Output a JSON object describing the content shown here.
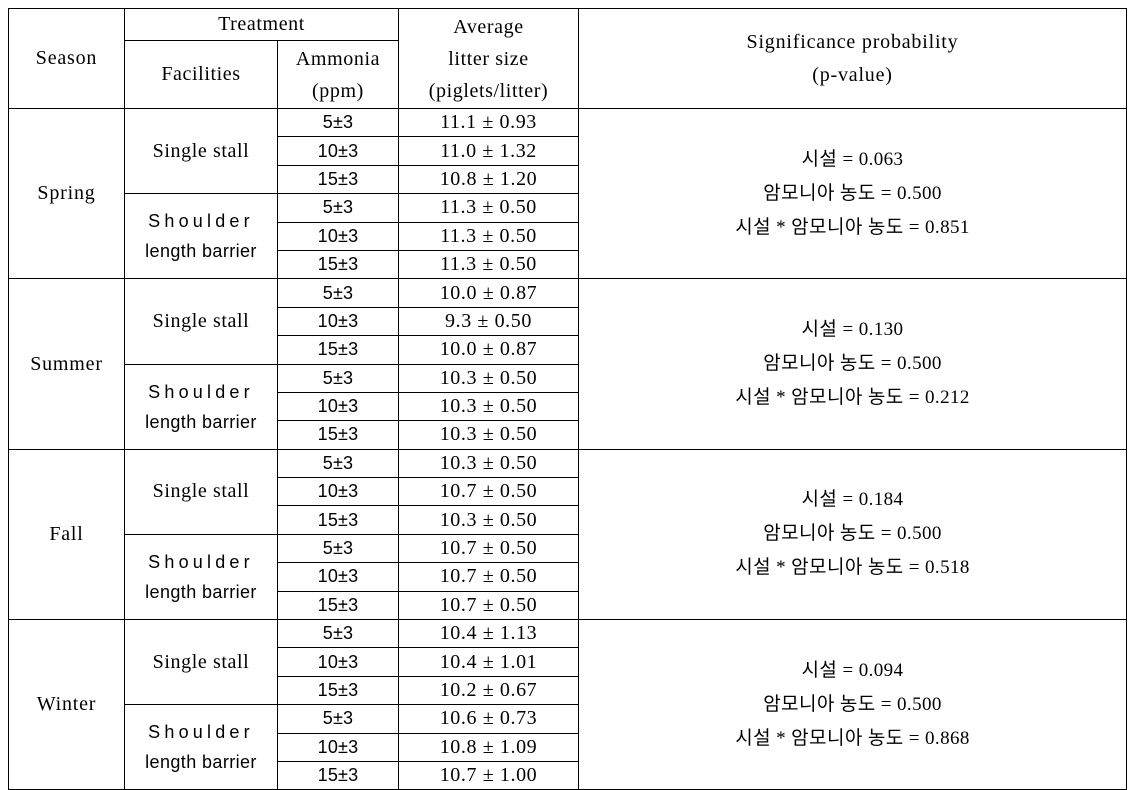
{
  "table": {
    "headers": {
      "season": "Season",
      "treatment": "Treatment",
      "facilities": "Facilities",
      "ammonia_line1": "Ammonia",
      "ammonia_line2": "(ppm)",
      "average_line1": "Average",
      "average_line2": "litter size",
      "average_line3": "(piglets/litter)",
      "significance_line1": "Significance probability",
      "significance_line2": "(p-value)"
    },
    "facility_labels": {
      "single_stall": "Single stall",
      "shoulder_word": "Shoulder",
      "shoulder_rest": "length barrier"
    },
    "ammonia_levels": [
      "5±3",
      "10±3",
      "15±3"
    ],
    "seasons": [
      {
        "name": "Spring",
        "groups": [
          {
            "facility": "Single stall",
            "rows": [
              {
                "ammonia": "5±3",
                "litter_size": "11.1 ± 0.93"
              },
              {
                "ammonia": "10±3",
                "litter_size": "11.0 ± 1.32"
              },
              {
                "ammonia": "15±3",
                "litter_size": "10.8 ± 1.20"
              }
            ]
          },
          {
            "facility": "Shoulder length barrier",
            "rows": [
              {
                "ammonia": "5±3",
                "litter_size": "11.3 ± 0.50"
              },
              {
                "ammonia": "10±3",
                "litter_size": "11.3 ± 0.50"
              },
              {
                "ammonia": "15±3",
                "litter_size": "11.3 ± 0.50"
              }
            ]
          }
        ],
        "significance": {
          "line1": "시설 = 0.063",
          "line2": "암모니아 농도 = 0.500",
          "line3": "시설 * 암모니아 농도 = 0.851"
        }
      },
      {
        "name": "Summer",
        "groups": [
          {
            "facility": "Single stall",
            "rows": [
              {
                "ammonia": "5±3",
                "litter_size": "10.0 ± 0.87"
              },
              {
                "ammonia": "10±3",
                "litter_size": "9.3 ± 0.50"
              },
              {
                "ammonia": "15±3",
                "litter_size": "10.0 ± 0.87"
              }
            ]
          },
          {
            "facility": "Shoulder length barrier",
            "rows": [
              {
                "ammonia": "5±3",
                "litter_size": "10.3 ± 0.50"
              },
              {
                "ammonia": "10±3",
                "litter_size": "10.3 ± 0.50"
              },
              {
                "ammonia": "15±3",
                "litter_size": "10.3 ± 0.50"
              }
            ]
          }
        ],
        "significance": {
          "line1": "시설 = 0.130",
          "line2": "암모니아 농도 = 0.500",
          "line3": "시설 * 암모니아 농도 = 0.212"
        }
      },
      {
        "name": "Fall",
        "groups": [
          {
            "facility": "Single stall",
            "rows": [
              {
                "ammonia": "5±3",
                "litter_size": "10.3 ± 0.50"
              },
              {
                "ammonia": "10±3",
                "litter_size": "10.7 ± 0.50"
              },
              {
                "ammonia": "15±3",
                "litter_size": "10.3 ± 0.50"
              }
            ]
          },
          {
            "facility": "Shoulder length barrier",
            "rows": [
              {
                "ammonia": "5±3",
                "litter_size": "10.7 ± 0.50"
              },
              {
                "ammonia": "10±3",
                "litter_size": "10.7 ± 0.50"
              },
              {
                "ammonia": "15±3",
                "litter_size": "10.7 ± 0.50"
              }
            ]
          }
        ],
        "significance": {
          "line1": "시설 = 0.184",
          "line2": "암모니아 농도 = 0.500",
          "line3": "시설 * 암모니아 농도 = 0.518"
        }
      },
      {
        "name": "Winter",
        "groups": [
          {
            "facility": "Single stall",
            "rows": [
              {
                "ammonia": "5±3",
                "litter_size": "10.4 ± 1.13"
              },
              {
                "ammonia": "10±3",
                "litter_size": "10.4 ± 1.01"
              },
              {
                "ammonia": "15±3",
                "litter_size": "10.2 ± 0.67"
              }
            ]
          },
          {
            "facility": "Shoulder length barrier",
            "rows": [
              {
                "ammonia": "5±3",
                "litter_size": "10.6 ± 0.73"
              },
              {
                "ammonia": "10±3",
                "litter_size": "10.8 ± 1.09"
              },
              {
                "ammonia": "15±3",
                "litter_size": "10.7 ± 1.00"
              }
            ]
          }
        ],
        "significance": {
          "line1": "시설 = 0.094",
          "line2": "암모니아 농도 = 0.500",
          "line3": "시설 * 암모니아 농도 = 0.868"
        }
      }
    ]
  }
}
